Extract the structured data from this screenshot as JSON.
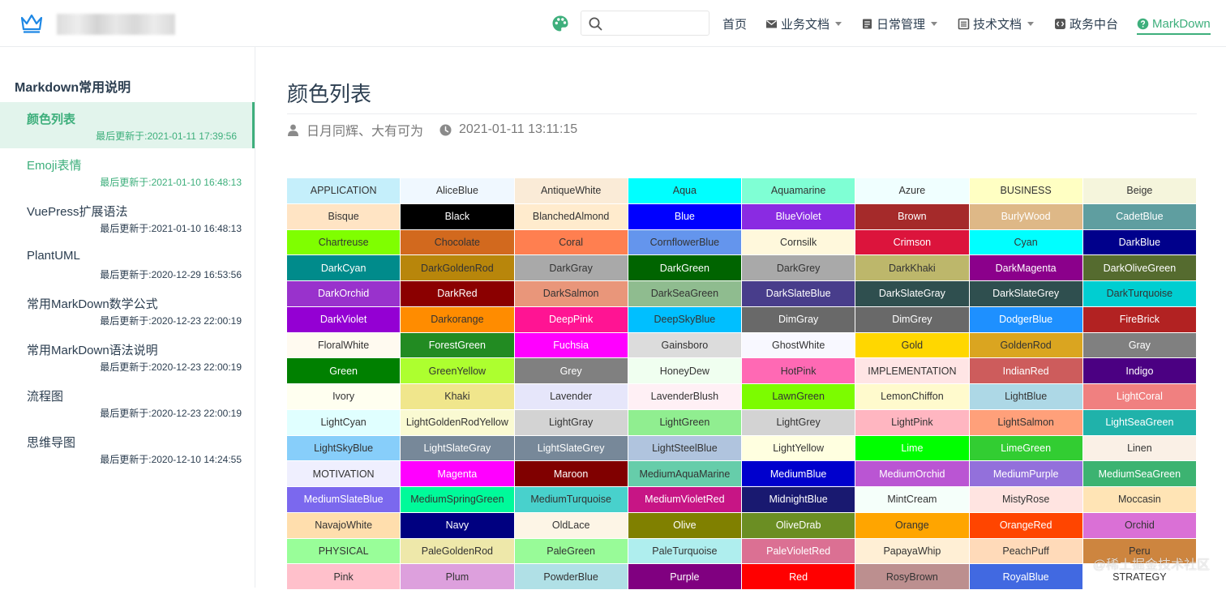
{
  "nav": {
    "items": [
      {
        "label": "首页",
        "icon": "",
        "caret": false,
        "active": false
      },
      {
        "label": "业务文档",
        "icon": "mail-icon",
        "caret": true,
        "active": false
      },
      {
        "label": "日常管理",
        "icon": "document-icon",
        "caret": true,
        "active": false
      },
      {
        "label": "技术文档",
        "icon": "list-icon",
        "caret": true,
        "active": false
      },
      {
        "label": "政务中台",
        "icon": "code-icon",
        "caret": false,
        "active": false
      },
      {
        "label": "MarkDown",
        "icon": "help-circle-icon",
        "caret": false,
        "active": true
      }
    ],
    "search_value": ""
  },
  "sidebar": {
    "heading": "Markdown常用说明",
    "items": [
      {
        "title": "颜色列表",
        "updated": "最后更新于:2021-01-11 17:39:56",
        "state": "active"
      },
      {
        "title": "Emoji表情",
        "updated": "最后更新于:2021-01-10 16:48:13",
        "state": "hl"
      },
      {
        "title": "VuePress扩展语法",
        "updated": "最后更新于:2021-01-10 16:48:13",
        "state": ""
      },
      {
        "title": "PlantUML",
        "updated": "最后更新于:2020-12-29 16:53:56",
        "state": ""
      },
      {
        "title": "常用MarkDown数学公式",
        "updated": "最后更新于:2020-12-23 22:00:19",
        "state": ""
      },
      {
        "title": "常用MarkDown语法说明",
        "updated": "最后更新于:2020-12-23 22:00:19",
        "state": ""
      },
      {
        "title": "流程图",
        "updated": "最后更新于:2020-12-23 22:00:19",
        "state": ""
      },
      {
        "title": "思维导图",
        "updated": "最后更新于:2020-12-10 14:24:55",
        "state": ""
      }
    ]
  },
  "page": {
    "title": "颜色列表",
    "author": "日月同辉、大有可为",
    "date": "2021-01-11 13:11:15"
  },
  "colors": [
    {
      "name": "APPLICATION",
      "bg": "#c5effb",
      "fg": "#333"
    },
    {
      "name": "AliceBlue",
      "bg": "#f0f8ff",
      "fg": "#333"
    },
    {
      "name": "AntiqueWhite",
      "bg": "#faebd7",
      "fg": "#333"
    },
    {
      "name": "Aqua",
      "bg": "#00ffff",
      "fg": "#333"
    },
    {
      "name": "Aquamarine",
      "bg": "#7fffd4",
      "fg": "#333"
    },
    {
      "name": "Azure",
      "bg": "#f0ffff",
      "fg": "#333"
    },
    {
      "name": "BUSINESS",
      "bg": "#ffffc3",
      "fg": "#333"
    },
    {
      "name": "Beige",
      "bg": "#f5f5dc",
      "fg": "#333"
    },
    {
      "name": "Bisque",
      "bg": "#ffe4c4",
      "fg": "#333"
    },
    {
      "name": "Black",
      "bg": "#000000",
      "fg": "#fff"
    },
    {
      "name": "BlanchedAlmond",
      "bg": "#ffebcd",
      "fg": "#333"
    },
    {
      "name": "Blue",
      "bg": "#0000ff",
      "fg": "#fff"
    },
    {
      "name": "BlueViolet",
      "bg": "#8a2be2",
      "fg": "#fff"
    },
    {
      "name": "Brown",
      "bg": "#a52a2a",
      "fg": "#fff"
    },
    {
      "name": "BurlyWood",
      "bg": "#deb887",
      "fg": "#fff"
    },
    {
      "name": "CadetBlue",
      "bg": "#5f9ea0",
      "fg": "#fff"
    },
    {
      "name": "Chartreuse",
      "bg": "#7fff00",
      "fg": "#333"
    },
    {
      "name": "Chocolate",
      "bg": "#d2691e",
      "fg": "#333"
    },
    {
      "name": "Coral",
      "bg": "#ff7f50",
      "fg": "#333"
    },
    {
      "name": "CornflowerBlue",
      "bg": "#6495ed",
      "fg": "#333"
    },
    {
      "name": "Cornsilk",
      "bg": "#fff8dc",
      "fg": "#333"
    },
    {
      "name": "Crimson",
      "bg": "#dc143c",
      "fg": "#fff"
    },
    {
      "name": "Cyan",
      "bg": "#00ffff",
      "fg": "#333"
    },
    {
      "name": "DarkBlue",
      "bg": "#00008b",
      "fg": "#fff"
    },
    {
      "name": "DarkCyan",
      "bg": "#008b8b",
      "fg": "#fff"
    },
    {
      "name": "DarkGoldenRod",
      "bg": "#b8860b",
      "fg": "#333"
    },
    {
      "name": "DarkGray",
      "bg": "#a9a9a9",
      "fg": "#333"
    },
    {
      "name": "DarkGreen",
      "bg": "#006400",
      "fg": "#fff"
    },
    {
      "name": "DarkGrey",
      "bg": "#a9a9a9",
      "fg": "#333"
    },
    {
      "name": "DarkKhaki",
      "bg": "#bdb76b",
      "fg": "#333"
    },
    {
      "name": "DarkMagenta",
      "bg": "#8b008b",
      "fg": "#fff"
    },
    {
      "name": "DarkOliveGreen",
      "bg": "#556b2f",
      "fg": "#fff"
    },
    {
      "name": "DarkOrchid",
      "bg": "#9932cc",
      "fg": "#fff"
    },
    {
      "name": "DarkRed",
      "bg": "#8b0000",
      "fg": "#fff"
    },
    {
      "name": "DarkSalmon",
      "bg": "#e9967a",
      "fg": "#333"
    },
    {
      "name": "DarkSeaGreen",
      "bg": "#8fbc8f",
      "fg": "#333"
    },
    {
      "name": "DarkSlateBlue",
      "bg": "#483d8b",
      "fg": "#fff"
    },
    {
      "name": "DarkSlateGray",
      "bg": "#2f4f4f",
      "fg": "#fff"
    },
    {
      "name": "DarkSlateGrey",
      "bg": "#2f4f4f",
      "fg": "#fff"
    },
    {
      "name": "DarkTurquoise",
      "bg": "#00ced1",
      "fg": "#333"
    },
    {
      "name": "DarkViolet",
      "bg": "#9400d3",
      "fg": "#fff"
    },
    {
      "name": "Darkorange",
      "bg": "#ff8c00",
      "fg": "#333"
    },
    {
      "name": "DeepPink",
      "bg": "#ff1493",
      "fg": "#fff"
    },
    {
      "name": "DeepSkyBlue",
      "bg": "#00bfff",
      "fg": "#333"
    },
    {
      "name": "DimGray",
      "bg": "#696969",
      "fg": "#fff"
    },
    {
      "name": "DimGrey",
      "bg": "#696969",
      "fg": "#fff"
    },
    {
      "name": "DodgerBlue",
      "bg": "#1e90ff",
      "fg": "#fff"
    },
    {
      "name": "FireBrick",
      "bg": "#b22222",
      "fg": "#fff"
    },
    {
      "name": "FloralWhite",
      "bg": "#fffaf0",
      "fg": "#333"
    },
    {
      "name": "ForestGreen",
      "bg": "#228b22",
      "fg": "#fff"
    },
    {
      "name": "Fuchsia",
      "bg": "#ff00ff",
      "fg": "#fff"
    },
    {
      "name": "Gainsboro",
      "bg": "#dcdcdc",
      "fg": "#333"
    },
    {
      "name": "GhostWhite",
      "bg": "#f8f8ff",
      "fg": "#333"
    },
    {
      "name": "Gold",
      "bg": "#ffd700",
      "fg": "#333"
    },
    {
      "name": "GoldenRod",
      "bg": "#daa520",
      "fg": "#333"
    },
    {
      "name": "Gray",
      "bg": "#808080",
      "fg": "#fff"
    },
    {
      "name": "Green",
      "bg": "#008000",
      "fg": "#fff"
    },
    {
      "name": "GreenYellow",
      "bg": "#adff2f",
      "fg": "#333"
    },
    {
      "name": "Grey",
      "bg": "#808080",
      "fg": "#fff"
    },
    {
      "name": "HoneyDew",
      "bg": "#f0fff0",
      "fg": "#333"
    },
    {
      "name": "HotPink",
      "bg": "#ff69b4",
      "fg": "#333"
    },
    {
      "name": "IMPLEMENTATION",
      "bg": "#ffe5e5",
      "fg": "#333"
    },
    {
      "name": "IndianRed",
      "bg": "#cd5c5c",
      "fg": "#fff"
    },
    {
      "name": "Indigo",
      "bg": "#4b0082",
      "fg": "#fff"
    },
    {
      "name": "Ivory",
      "bg": "#fffff0",
      "fg": "#333"
    },
    {
      "name": "Khaki",
      "bg": "#f0e68c",
      "fg": "#333"
    },
    {
      "name": "Lavender",
      "bg": "#e6e6fa",
      "fg": "#333"
    },
    {
      "name": "LavenderBlush",
      "bg": "#fff0f5",
      "fg": "#333"
    },
    {
      "name": "LawnGreen",
      "bg": "#7cfc00",
      "fg": "#333"
    },
    {
      "name": "LemonChiffon",
      "bg": "#fffacd",
      "fg": "#333"
    },
    {
      "name": "LightBlue",
      "bg": "#add8e6",
      "fg": "#333"
    },
    {
      "name": "LightCoral",
      "bg": "#f08080",
      "fg": "#fff"
    },
    {
      "name": "LightCyan",
      "bg": "#e0ffff",
      "fg": "#333"
    },
    {
      "name": "LightGoldenRodYellow",
      "bg": "#fafad2",
      "fg": "#333"
    },
    {
      "name": "LightGray",
      "bg": "#d3d3d3",
      "fg": "#333"
    },
    {
      "name": "LightGreen",
      "bg": "#90ee90",
      "fg": "#333"
    },
    {
      "name": "LightGrey",
      "bg": "#d3d3d3",
      "fg": "#333"
    },
    {
      "name": "LightPink",
      "bg": "#ffb6c1",
      "fg": "#333"
    },
    {
      "name": "LightSalmon",
      "bg": "#ffa07a",
      "fg": "#333"
    },
    {
      "name": "LightSeaGreen",
      "bg": "#20b2aa",
      "fg": "#fff"
    },
    {
      "name": "LightSkyBlue",
      "bg": "#87cefa",
      "fg": "#333"
    },
    {
      "name": "LightSlateGray",
      "bg": "#778899",
      "fg": "#fff"
    },
    {
      "name": "LightSlateGrey",
      "bg": "#778899",
      "fg": "#fff"
    },
    {
      "name": "LightSteelBlue",
      "bg": "#b0c4de",
      "fg": "#333"
    },
    {
      "name": "LightYellow",
      "bg": "#ffffe0",
      "fg": "#333"
    },
    {
      "name": "Lime",
      "bg": "#00ff00",
      "fg": "#fff"
    },
    {
      "name": "LimeGreen",
      "bg": "#32cd32",
      "fg": "#fff"
    },
    {
      "name": "Linen",
      "bg": "#faf0e6",
      "fg": "#333"
    },
    {
      "name": "MOTIVATION",
      "bg": "#efeffe",
      "fg": "#333"
    },
    {
      "name": "Magenta",
      "bg": "#ff00ff",
      "fg": "#fff"
    },
    {
      "name": "Maroon",
      "bg": "#800000",
      "fg": "#fff"
    },
    {
      "name": "MediumAquaMarine",
      "bg": "#66cdaa",
      "fg": "#333"
    },
    {
      "name": "MediumBlue",
      "bg": "#0000cd",
      "fg": "#fff"
    },
    {
      "name": "MediumOrchid",
      "bg": "#ba55d3",
      "fg": "#fff"
    },
    {
      "name": "MediumPurple",
      "bg": "#9370db",
      "fg": "#fff"
    },
    {
      "name": "MediumSeaGreen",
      "bg": "#3cb371",
      "fg": "#fff"
    },
    {
      "name": "MediumSlateBlue",
      "bg": "#7b68ee",
      "fg": "#fff"
    },
    {
      "name": "MediumSpringGreen",
      "bg": "#00fa9a",
      "fg": "#333"
    },
    {
      "name": "MediumTurquoise",
      "bg": "#48d1cc",
      "fg": "#333"
    },
    {
      "name": "MediumVioletRed",
      "bg": "#c71585",
      "fg": "#fff"
    },
    {
      "name": "MidnightBlue",
      "bg": "#191970",
      "fg": "#fff"
    },
    {
      "name": "MintCream",
      "bg": "#f5fffa",
      "fg": "#333"
    },
    {
      "name": "MistyRose",
      "bg": "#ffe4e1",
      "fg": "#333"
    },
    {
      "name": "Moccasin",
      "bg": "#ffe4b5",
      "fg": "#333"
    },
    {
      "name": "NavajoWhite",
      "bg": "#ffdead",
      "fg": "#333"
    },
    {
      "name": "Navy",
      "bg": "#000080",
      "fg": "#fff"
    },
    {
      "name": "OldLace",
      "bg": "#fdf5e6",
      "fg": "#333"
    },
    {
      "name": "Olive",
      "bg": "#808000",
      "fg": "#fff"
    },
    {
      "name": "OliveDrab",
      "bg": "#6b8e23",
      "fg": "#fff"
    },
    {
      "name": "Orange",
      "bg": "#ffa500",
      "fg": "#333"
    },
    {
      "name": "OrangeRed",
      "bg": "#ff4500",
      "fg": "#fff"
    },
    {
      "name": "Orchid",
      "bg": "#da70d6",
      "fg": "#333"
    },
    {
      "name": "PHYSICAL",
      "bg": "#99fe99",
      "fg": "#333"
    },
    {
      "name": "PaleGoldenRod",
      "bg": "#eee8aa",
      "fg": "#333"
    },
    {
      "name": "PaleGreen",
      "bg": "#98fb98",
      "fg": "#333"
    },
    {
      "name": "PaleTurquoise",
      "bg": "#afeeee",
      "fg": "#333"
    },
    {
      "name": "PaleVioletRed",
      "bg": "#db7093",
      "fg": "#fff"
    },
    {
      "name": "PapayaWhip",
      "bg": "#ffefd5",
      "fg": "#333"
    },
    {
      "name": "PeachPuff",
      "bg": "#ffdab9",
      "fg": "#333"
    },
    {
      "name": "Peru",
      "bg": "#cd853f",
      "fg": "#333"
    },
    {
      "name": "Pink",
      "bg": "#ffc0cb",
      "fg": "#333"
    },
    {
      "name": "Plum",
      "bg": "#dda0dd",
      "fg": "#333"
    },
    {
      "name": "PowderBlue",
      "bg": "#b0e0e6",
      "fg": "#333"
    },
    {
      "name": "Purple",
      "bg": "#800080",
      "fg": "#fff"
    },
    {
      "name": "Red",
      "bg": "#ff0000",
      "fg": "#fff"
    },
    {
      "name": "RosyBrown",
      "bg": "#bc8f8f",
      "fg": "#333"
    },
    {
      "name": "RoyalBlue",
      "bg": "#4169e1",
      "fg": "#fff"
    },
    {
      "name": "STRATEGY",
      "bg": "#ffffff",
      "fg": "#333"
    }
  ],
  "watermark": "@稀土掘金技术社区",
  "theme": {
    "accent": "#3eaf7c",
    "text": "#2c3e50"
  }
}
